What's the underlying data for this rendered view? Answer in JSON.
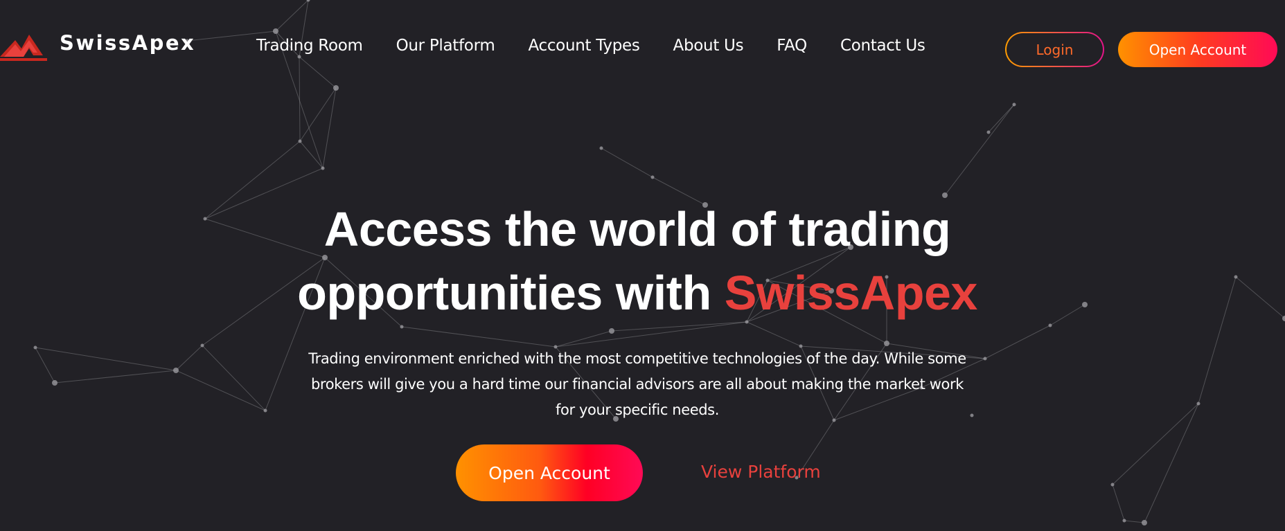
{
  "header": {
    "brand": "SwissApex",
    "nav": [
      {
        "label": "Trading Room"
      },
      {
        "label": "Our Platform"
      },
      {
        "label": "Account Types"
      },
      {
        "label": "About Us"
      },
      {
        "label": "FAQ"
      },
      {
        "label": "Contact Us"
      }
    ],
    "login_label": "Login",
    "open_account_label": "Open Account"
  },
  "hero": {
    "title_line1": "Access the world of trading",
    "title_line2_prefix": "opportunities with ",
    "title_accent": "SwissApex",
    "subtitle": "Trading environment enriched with the most competitive technologies of the day. While some brokers will give you a hard time our financial advisors are all about making the market work for your specific needs.",
    "primary_cta": "Open Account",
    "secondary_cta": "View Platform"
  },
  "colors": {
    "background": "#222126",
    "accent": "#e8413d",
    "gradient_start": "#ff9100",
    "gradient_end": "#ff0a56"
  }
}
